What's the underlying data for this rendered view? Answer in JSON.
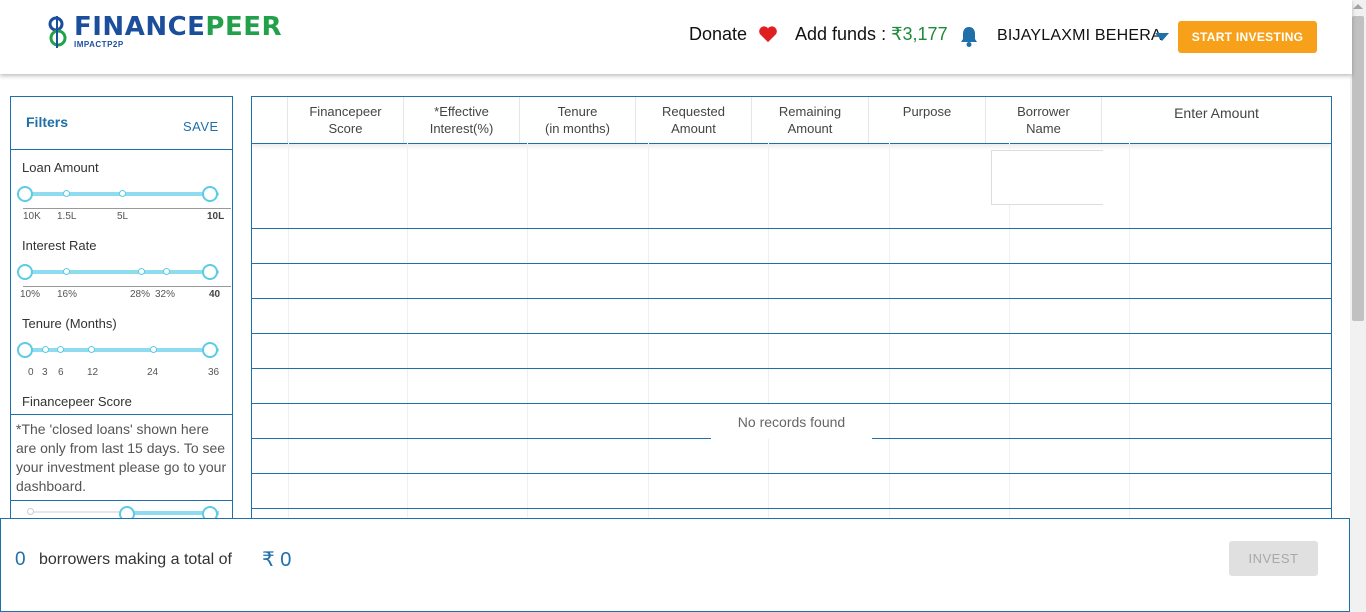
{
  "header": {
    "logo_main_a": "FINANCE",
    "logo_main_b": "PEER",
    "logo_sub": "IMPACTP2P",
    "donate_label": "Donate",
    "funds_label": "Add funds : ",
    "funds_value": "₹3,177",
    "user_name": "BIJAYLAXMI BEHERA",
    "start_investing_label": "START INVESTING",
    "icons": [
      "heart-icon",
      "bell-icon",
      "caret-down-icon"
    ],
    "colors": {
      "accent": "#f7a11a",
      "brand_blue": "#1b4f9c",
      "brand_green": "#22a04a",
      "heart": "#e02020"
    }
  },
  "filters": {
    "title": "Filters",
    "save_label": "SAVE",
    "groups": [
      {
        "label": "Loan Amount",
        "ticks": [
          "10K",
          "1.5L",
          "5L",
          "10L"
        ]
      },
      {
        "label": "Interest Rate",
        "ticks": [
          "10%",
          "16%",
          "28%",
          "32%",
          "40"
        ]
      },
      {
        "label": "Tenure (Months)",
        "ticks": [
          "0",
          "3",
          "6",
          "12",
          "24",
          "36"
        ]
      },
      {
        "label": "Financepeer Score"
      }
    ],
    "note": "*The 'closed loans' shown here are only from last 15 days. To see your investment please go to your dashboard."
  },
  "table": {
    "columns": [
      {
        "l1": "Financepeer",
        "l2": "Score"
      },
      {
        "l1": "*Effective",
        "l2": "Interest(%)"
      },
      {
        "l1": "Tenure",
        "l2": "(in months)"
      },
      {
        "l1": "Requested",
        "l2": "Amount"
      },
      {
        "l1": "Remaining",
        "l2": "Amount"
      },
      {
        "l1": "Purpose",
        "l2": ""
      },
      {
        "l1": "Borrower",
        "l2": "Name"
      },
      {
        "l1": "Enter Amount",
        "l2": ""
      }
    ],
    "empty_message": "No records found"
  },
  "summary": {
    "count": "0",
    "text": "borrowers making a total of",
    "total": "₹ 0",
    "invest_label": "INVEST"
  }
}
